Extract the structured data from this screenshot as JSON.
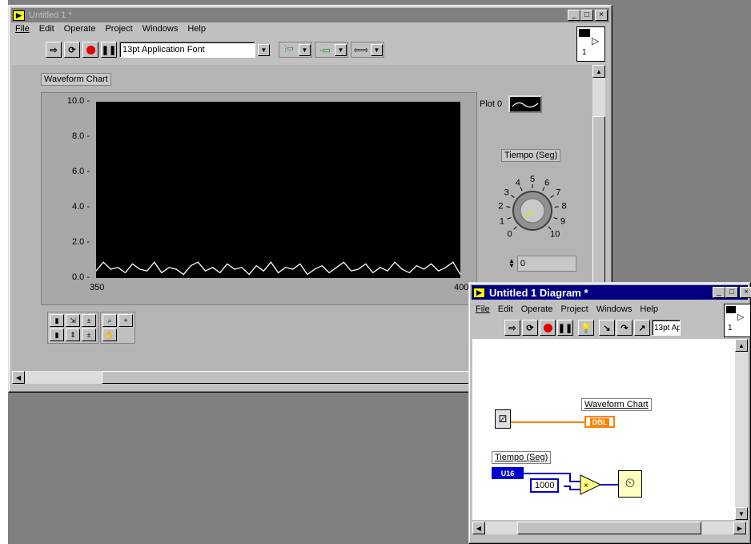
{
  "front_panel": {
    "title": "Untitled 1 *",
    "menus": [
      "File",
      "Edit",
      "Operate",
      "Project",
      "Windows",
      "Help"
    ],
    "font_selector": "13pt Application Font",
    "chart_label": "Waveform Chart",
    "legend_label": "Plot 0",
    "knob_label": "Tiempo (Seg)",
    "knob_scale": [
      "0",
      "1",
      "2",
      "3",
      "4",
      "5",
      "6",
      "7",
      "8",
      "9",
      "10"
    ],
    "digital_value": "0",
    "connector_text": "1"
  },
  "diagram": {
    "title": "Untitled 1 Diagram *",
    "menus": [
      "File",
      "Edit",
      "Operate",
      "Project",
      "Windows",
      "Help"
    ],
    "font_selector": "13pt Ap",
    "connector_text": "1",
    "chart_terminal_label": "Waveform Chart",
    "chart_terminal_type": "DBL",
    "knob_terminal_label": "Tiempo (Seg)",
    "knob_terminal_type": "U16",
    "constant_value": "1000"
  },
  "colors": {
    "desktop": "#808080",
    "panel_bg": "#b4b4b4",
    "plot_bg": "#000000",
    "plot_line": "#ffffff",
    "wire_orange": "#ff8000",
    "wire_blue": "#0000d0",
    "active_title": "#000080",
    "inactive_title": "#808080"
  },
  "chart_data": {
    "type": "line",
    "ylim": [
      0,
      10
    ],
    "yticks": [
      "10.0",
      "8.0",
      "6.0",
      "4.0",
      "2.0",
      "0.0"
    ],
    "xticks": [
      "350",
      "400"
    ],
    "xlim": [
      350,
      400
    ],
    "series": [
      {
        "values": [
          0.4,
          0.9,
          0.5,
          0.6,
          0.3,
          0.8,
          0.5,
          0.4,
          0.9,
          0.3,
          0.6,
          0.5,
          0.2,
          0.7,
          0.9,
          0.4,
          0.6,
          0.3,
          0.8,
          0.5,
          0.6,
          0.2,
          0.7,
          0.4,
          0.9,
          0.3,
          0.6,
          0.5,
          0.8,
          0.2,
          0.5,
          0.7,
          0.3,
          0.6,
          0.9,
          0.4,
          0.5,
          0.8,
          0.3,
          0.6,
          0.4,
          0.9,
          0.5,
          0.3,
          0.7,
          0.5,
          0.8,
          0.4,
          0.6,
          0.9,
          0.2
        ]
      }
    ]
  }
}
